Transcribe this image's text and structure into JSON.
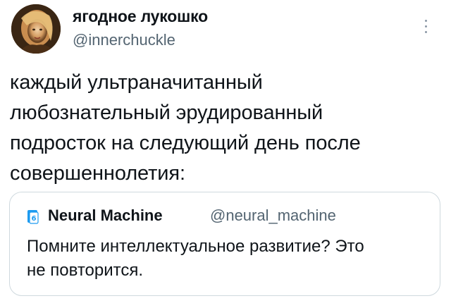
{
  "tweet": {
    "author": {
      "display_name": "ягодное лукошко",
      "handle": "@innerchuckle"
    },
    "text": "каждый ультраначитанный\nлюбознательный эрудированный\nподросток на следующий день после\nсовершеннолетия:",
    "more_icon": "more-vertical-icon"
  },
  "quoted_tweet": {
    "author": {
      "display_name": "Neural Machine",
      "handle": "@neural_machine",
      "avatar_icon": "neural-machine-logo-icon"
    },
    "text": "Помните интеллектуальное развитие? Это\nне повторится."
  },
  "colors": {
    "text_primary": "#0f1419",
    "text_secondary": "#536471",
    "border": "#cfd9de",
    "accent_blue": "#1d9bf0"
  }
}
